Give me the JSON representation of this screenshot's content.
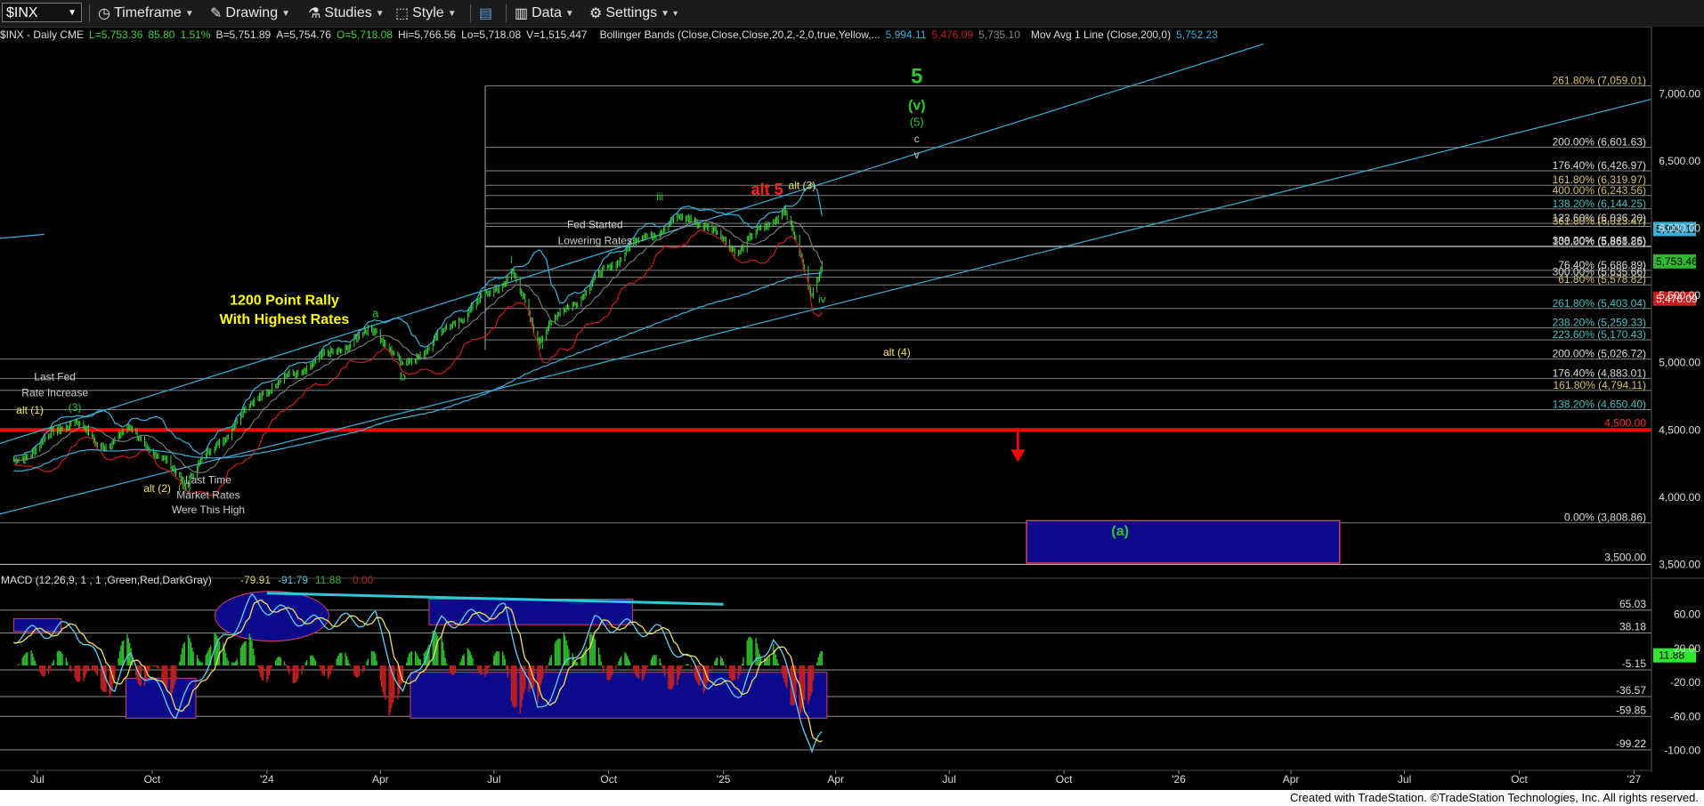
{
  "toolbar": {
    "symbol": "$INX",
    "timeframe": "Timeframe",
    "drawing": "Drawing",
    "studies": "Studies",
    "style": "Style",
    "data": "Data",
    "settings": "Settings"
  },
  "info": {
    "symbol": "$INX - Daily  CME",
    "last": "L=5,753.36",
    "change": "85.80",
    "pct": "1.51%",
    "bid": "B=5,751.89",
    "ask": "A=5,754.76",
    "open": "O=5,718.08",
    "hi": "Hi=5,766.56",
    "lo": "Lo=5,718.08",
    "vol": "V=1,515,447",
    "bb_label": "Bollinger Bands (Close,Close,Close,20,2,-2,0,true,Yellow,...",
    "bb_upper": "5,994.11",
    "bb_lower": "5,476.09",
    "bb_mid": "5,735.10",
    "ma_label": "Mov Avg 1 Line (Close,200,0)",
    "ma_value": "5,752.23"
  },
  "footer": "Created with TradeStation. ©TradeStation Technologies, Inc. All rights reserved.",
  "colors": {
    "background": "#000000",
    "price_up": "#3bd43b",
    "bollinger_upper": "#3ab0d8",
    "bollinger_lower": "#c81e1e",
    "ma200": "#3ab0d8",
    "macd_line": "#5fd0f0",
    "signal_line": "#f0e060",
    "hist_pos": "#2eb82e",
    "hist_neg": "#c02020",
    "support_line": "#ff0000",
    "box_fill": "#0a0a8a",
    "box_border": "#d0406a"
  },
  "chart_data": [
    {
      "type": "candlestick",
      "title": "$INX - Daily",
      "x_ticks": [
        "Jul",
        "Oct",
        "'24",
        "Apr",
        "Jul",
        "Oct",
        "'25",
        "Apr",
        "Jul",
        "Oct",
        "'26",
        "Apr",
        "Jul",
        "Oct",
        "'27"
      ],
      "y_ticks": [
        "7,000.00",
        "6,500.00",
        "6,000.00",
        "5,500.00",
        "5,000.00",
        "4,500.00",
        "4,000.00",
        "3,500.00"
      ],
      "ylim": [
        3430,
        7380
      ],
      "price_path": [
        {
          "x": "2023-06-12",
          "y": 4250
        },
        {
          "x": "2023-07-31",
          "y": 4590
        },
        {
          "x": "2023-08-18",
          "y": 4370
        },
        {
          "x": "2023-09-14",
          "y": 4500
        },
        {
          "x": "2023-10-27",
          "y": 4117
        },
        {
          "x": "2023-12-28",
          "y": 4780
        },
        {
          "x": "2024-03-28",
          "y": 5254
        },
        {
          "x": "2024-04-19",
          "y": 4967
        },
        {
          "x": "2024-07-16",
          "y": 5667
        },
        {
          "x": "2024-08-05",
          "y": 5186
        },
        {
          "x": "2024-10-18",
          "y": 5864
        },
        {
          "x": "2024-11-11",
          "y": 6001
        },
        {
          "x": "2024-12-06",
          "y": 6090
        },
        {
          "x": "2025-01-13",
          "y": 5836
        },
        {
          "x": "2025-02-19",
          "y": 6144
        },
        {
          "x": "2025-03-13",
          "y": 5521
        },
        {
          "x": "2025-03-21",
          "y": 5753
        }
      ],
      "fib_levels": [
        {
          "label": "261.80% (7,059.01)",
          "value": 7059.01
        },
        {
          "label": "200.00% (6,601.63)",
          "value": 6601.63
        },
        {
          "label": "176.40% (6,426.97)",
          "value": 6426.97
        },
        {
          "label": "161.80% (6,319.97)",
          "value": 6319.97
        },
        {
          "label": "400.00% (6,243.56)",
          "value": 6243.56
        },
        {
          "label": "138.20% (6,144.25)",
          "value": 6144.25
        },
        {
          "label": "123.60% (6,036.20)",
          "value": 6036.2
        },
        {
          "label": "361.80% (6,013.47)",
          "value": 6013.47
        },
        {
          "label": "338.20% (5,868.26)",
          "value": 5868.26
        },
        {
          "label": "100.00% (5,861.85)",
          "value": 5861.85
        },
        {
          "label": "76.40% (5,686.89)",
          "value": 5686.89
        },
        {
          "label": "300.00% (5,635.66)",
          "value": 5635.66
        },
        {
          "label": "61.80% (5,578.82)",
          "value": 5578.82
        },
        {
          "label": "261.80% (5,403.04)",
          "value": 5403.04
        },
        {
          "label": "238.20% (5,259.33)",
          "value": 5259.33
        },
        {
          "label": "223.60% (5,170.43)",
          "value": 5170.43
        },
        {
          "label": "200.00% (5,026.72)",
          "value": 5026.72
        },
        {
          "label": "176.40% (4,883.01)",
          "value": 4883.01
        },
        {
          "label": "161.80% (4,794.11)",
          "value": 4794.11
        },
        {
          "label": "138.20% (4,650.40)",
          "value": 4650.4
        },
        {
          "label": "0.00% (3,808.86)",
          "value": 3808.86
        }
      ],
      "horizontal_levels": [
        {
          "label": "4,500.00",
          "value": 4500,
          "color": "#ff0000"
        },
        {
          "label": "3,500.00",
          "value": 3500,
          "color": "#cccccc"
        }
      ],
      "right_tags": [
        {
          "label": "5,994.11",
          "value": 5994.11,
          "bg": "#3ab0d8",
          "fg": "#000"
        },
        {
          "label": "5,753.46",
          "value": 5753.46,
          "bg": "#2eb82e",
          "fg": "#000"
        },
        {
          "label": "5,476.09",
          "value": 5476.09,
          "bg": "#c81e1e",
          "fg": "#fff"
        }
      ],
      "annotations": [
        {
          "text": "5",
          "color": "#2ec82e",
          "x": "2025-06-05",
          "y": 7080,
          "size": 24
        },
        {
          "text": "(v)",
          "color": "#2ec82e",
          "x": "2025-06-05",
          "y": 6880,
          "size": 16
        },
        {
          "text": "(5)",
          "color": "#2ec82e",
          "x": "2025-06-05",
          "y": 6760,
          "size": 13
        },
        {
          "text": "c",
          "color": "#cccccc",
          "x": "2025-06-05",
          "y": 6640,
          "size": 12
        },
        {
          "text": "v",
          "color": "#cccccc",
          "x": "2025-06-05",
          "y": 6520,
          "size": 12
        },
        {
          "text": "alt 5",
          "color": "#ff2020",
          "x": "2025-02-05",
          "y": 6250,
          "size": 18
        },
        {
          "text": "alt (3)",
          "color": "#f0e060",
          "x": "2025-03-05",
          "y": 6290,
          "size": 12
        },
        {
          "text": "iii",
          "color": "#2ec82e",
          "x": "2024-11-11",
          "y": 6210,
          "size": 12
        },
        {
          "text": "i",
          "color": "#2ec82e",
          "x": "2024-07-15",
          "y": 5740,
          "size": 12
        },
        {
          "text": "ii",
          "color": "#2ec82e",
          "x": "2024-08-08",
          "y": 5100,
          "size": 12
        },
        {
          "text": "iv",
          "color": "#2ec82e",
          "x": "2025-03-21",
          "y": 5445,
          "size": 12
        },
        {
          "text": "alt (4)",
          "color": "#f0e060",
          "x": "2025-05-20",
          "y": 5050,
          "size": 12
        },
        {
          "text": "a",
          "color": "#2ec82e",
          "x": "2024-03-28",
          "y": 5340,
          "size": 13
        },
        {
          "text": "b",
          "color": "#2ec82e",
          "x": "2024-04-19",
          "y": 4870,
          "size": 13
        },
        {
          "text": "(3)",
          "color": "#2ec82e",
          "x": "2023-07-31",
          "y": 4640,
          "size": 12
        },
        {
          "text": "(4)",
          "color": "#2ec82e",
          "x": "2023-10-27",
          "y": 4050,
          "size": 12
        },
        {
          "text": "alt (1)",
          "color": "#f0e060",
          "x": "2023-06-25",
          "y": 4620,
          "size": 12
        },
        {
          "text": "alt (2)",
          "color": "#f0e060",
          "x": "2023-10-05",
          "y": 4040,
          "size": 12
        },
        {
          "text": "(a)",
          "color": "#2ec82e",
          "x": "2025-11-15",
          "y": 3715,
          "size": 16
        },
        {
          "text": "1200 Point Rally",
          "color": "#ffff00",
          "x": "2024-01-15",
          "y": 5430,
          "size": 16
        },
        {
          "text": "With Highest Rates",
          "color": "#ffff00",
          "x": "2024-01-15",
          "y": 5290,
          "size": 16
        },
        {
          "text": "Fed Started",
          "color": "#cccccc",
          "x": "2024-09-20",
          "y": 6000,
          "size": 12
        },
        {
          "text": "Lowering Rates",
          "color": "#cccccc",
          "x": "2024-09-20",
          "y": 5880,
          "size": 12
        },
        {
          "text": "Last Fed",
          "color": "#cccccc",
          "x": "2023-07-15",
          "y": 4870,
          "size": 12
        },
        {
          "text": "Rate Increase",
          "color": "#cccccc",
          "x": "2023-07-15",
          "y": 4750,
          "size": 12
        },
        {
          "text": "Last Time",
          "color": "#cccccc",
          "x": "2023-11-15",
          "y": 4100,
          "size": 12
        },
        {
          "text": "Market Rates",
          "color": "#cccccc",
          "x": "2023-11-15",
          "y": 3990,
          "size": 12
        },
        {
          "text": "Were This High",
          "color": "#cccccc",
          "x": "2023-11-15",
          "y": 3880,
          "size": 12
        }
      ]
    },
    {
      "type": "line",
      "title": "MACD (12,26,9, 1 , 1 ,Green,Red,DarkGray)",
      "values_text": [
        "-79.91",
        "-91.79",
        "11.88",
        "0.00"
      ],
      "y_ticks": [
        "60.00",
        "20.00",
        "-20.00",
        "-60.00",
        "-100.00"
      ],
      "ylim": [
        -115,
        90
      ],
      "levels": [
        {
          "label": "65.03",
          "value": 65.03
        },
        {
          "label": "38.18",
          "value": 38.18
        },
        {
          "label": "-5.15",
          "value": -5.15
        },
        {
          "label": "-36.57",
          "value": -36.57
        },
        {
          "label": "-59.85",
          "value": -59.85
        },
        {
          "label": "-99.22",
          "value": -99.22
        }
      ],
      "current_tag": {
        "label": "11.88",
        "value": 11.88
      },
      "macd_path": [
        {
          "x": "2023-06-12",
          "y": 35
        },
        {
          "x": "2023-07-31",
          "y": 45
        },
        {
          "x": "2023-09-01",
          "y": -25
        },
        {
          "x": "2023-09-14",
          "y": 10
        },
        {
          "x": "2023-10-20",
          "y": -55
        },
        {
          "x": "2023-11-20",
          "y": 15
        },
        {
          "x": "2023-12-20",
          "y": 75
        },
        {
          "x": "2024-02-05",
          "y": 50
        },
        {
          "x": "2024-03-28",
          "y": 55
        },
        {
          "x": "2024-04-19",
          "y": -35
        },
        {
          "x": "2024-05-20",
          "y": 50
        },
        {
          "x": "2024-07-10",
          "y": 65
        },
        {
          "x": "2024-08-05",
          "y": -55
        },
        {
          "x": "2024-09-20",
          "y": 50
        },
        {
          "x": "2024-10-20",
          "y": 45
        },
        {
          "x": "2024-11-10",
          "y": 40
        },
        {
          "x": "2024-12-20",
          "y": -20
        },
        {
          "x": "2025-01-15",
          "y": -30
        },
        {
          "x": "2025-02-10",
          "y": 35
        },
        {
          "x": "2025-03-01",
          "y": -40
        },
        {
          "x": "2025-03-13",
          "y": -108
        },
        {
          "x": "2025-03-21",
          "y": -79.91
        }
      ]
    }
  ]
}
